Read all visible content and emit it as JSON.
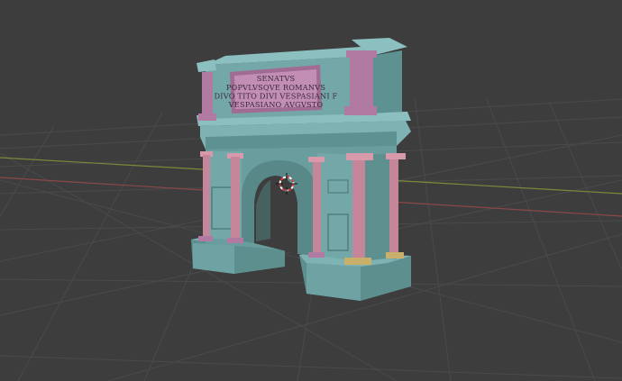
{
  "viewport": {
    "background": "#3d3d3d",
    "grid_color": "#4a4a4a",
    "x_axis_color": "#8a4848",
    "y_axis_color": "#7a8a3a"
  },
  "model": {
    "body_color": "#6fa3a3",
    "accent_color": "#b07aa3",
    "column_color": "#c5869a",
    "inscription": [
      "SENATVS",
      "POPVLVSQVE ROMANVS",
      "DIVO TITO DIVI VESPASIANI F",
      "VESPASIANO AVGVSTO"
    ]
  },
  "cursor_3d": {
    "icon": "3d-cursor-icon",
    "ring_color": "#e04040"
  }
}
